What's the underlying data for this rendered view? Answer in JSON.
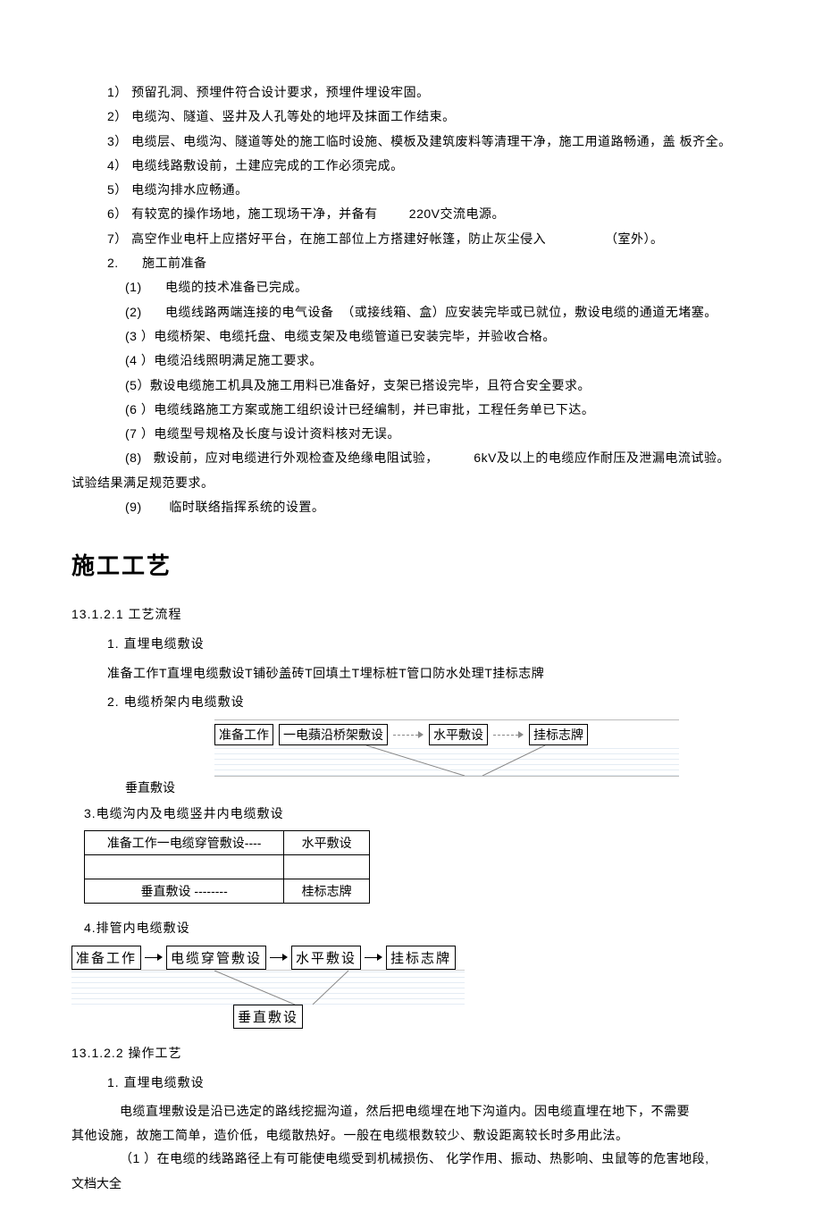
{
  "prep_lines": {
    "l1": "1） 预留孔洞、预埋件符合设计要求，预埋件埋设牢固。",
    "l2": "2） 电缆沟、隧道、竖井及人孔等处的地坪及抹面工作结束。",
    "l3": "3） 电缆层、电缆沟、隧道等处的施工临时设施、模板及建筑废料等清理干净，施工用道路畅通，盖 板齐全。",
    "l4": "4） 电缆线路敷设前，土建应完成的工作必须完成。",
    "l5": "5） 电缆沟排水应畅通。",
    "l6": "6） 有较宽的操作场地，施工现场干净，并备有        220V交流电源。",
    "l7": "7） 高空作业电杆上应搭好平台，在施工部位上方搭建好帐篷，防止灰尘侵入               （室外）。",
    "l8": "2.      施工前准备",
    "p1": "(1)      电缆的技术准备已完成。",
    "p2": "(2)      电缆线路两端连接的电气设备  （或接线箱、盒）应安装完毕或已就位，敷设电缆的通道无堵塞。",
    "p3": "(3 ）电缆桥架、电缆托盘、电缆支架及电缆管道已安装完毕，并验收合格。",
    "p4": "(4 ）电缆沿线照明满足施工要求。",
    "p5": "(5）敷设电缆施工机具及施工用料已准备好，支架已搭设完毕，且符合安全要求。",
    "p6": "(6 ）电缆线路施工方案或施工组织设计已经编制，并已审批，工程任务单已下达。",
    "p7": "(7 ）电缆型号规格及长度与设计资料核对无误。",
    "p8a": "(8)   敷设前，应对电缆进行外观检查及绝缘电阻试验，         6kV及以上的电缆应作耐压及泄漏电流试验。",
    "p8b": "试验结果满足规范要求。",
    "p9": "(9)       临时联络指挥系统的设置。"
  },
  "heading": "施工工艺",
  "s13_1_2_1": "13.1.2.1    工艺流程",
  "item1_title": "1.   直埋电缆敷设",
  "item1_flow": "准备工作T直埋电缆敷设T铺砂盖砖T回填土T埋标桩T管口防水处理T挂标志牌",
  "item2_title": "2.   电缆桥架内电缆敷设",
  "diag2": {
    "b1": "准备工作",
    "b2": "一电蘋沿桥架敷设",
    "b3": "水平敷设",
    "b4": "挂标志牌",
    "below_label": "垂直敷设"
  },
  "item3_title": "3.电缆沟内及电缆竖井内电缆敷设",
  "diag3": {
    "r1c1": "准备工作一电缆穿管敷设----",
    "r1c2": "水平敷设",
    "r2c1": "垂直敷设  --------",
    "r2c2": "桂标志牌"
  },
  "item4_title": "4.排管内电缆敷设",
  "diag4": {
    "b1": "准备工作",
    "b2": "电缆穿管敷设",
    "b3": "水平敷设",
    "b4": "挂标志牌",
    "b5": "垂直敷设"
  },
  "s13_1_2_2": "13.1.2.2    操作工艺",
  "op1_title": "1.     直埋电缆敷设",
  "op_para1": "电缆直埋敷设是沿已选定的路线挖掘沟道，然后把电缆埋在地下沟道内。因电缆直埋在地下，不需要",
  "op_para2": "其他设施，故施工简单，造价低，电缆散热好。一般在电缆根数较少、敷设距离较长时多用此法。",
  "op_para3": "（1 ）在电缆的线路路径上有可能使电缆受到机械损伤、          化学作用、振动、热影响、虫鼠等的危害地段,",
  "footer": "文档大全"
}
